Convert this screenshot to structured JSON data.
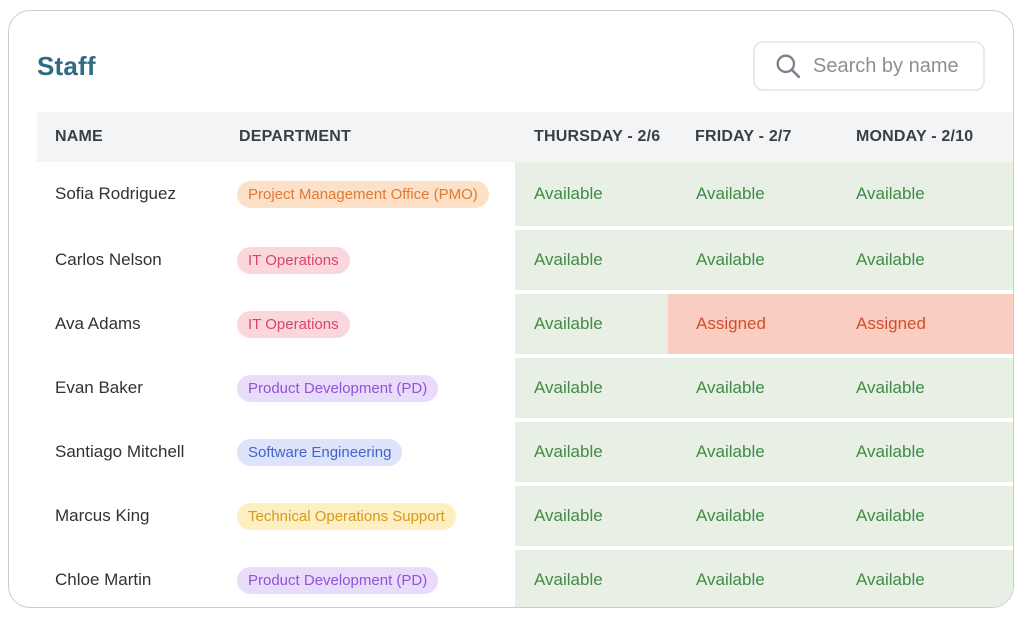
{
  "title": "Staff",
  "search": {
    "placeholder": "Search by name",
    "icon": "search-icon"
  },
  "columns": {
    "name": "NAME",
    "department": "DEPARTMENT",
    "day1": "THURSDAY - 2/6",
    "day2": "FRIDAY - 2/7",
    "day3": "MONDAY - 2/10"
  },
  "colors": {
    "title": "#2f6b82",
    "available_text": "#3f8a45",
    "available_bg": "#e8f0e6",
    "assigned_text": "#cf4f2f",
    "assigned_bg": "#f9cdbf"
  },
  "rows": [
    {
      "name": "Sofia Rodriguez",
      "department": "Project Management Office (PMO)",
      "dept_style": "pmo",
      "day1": "Available",
      "day2": "Available",
      "day3": "Available"
    },
    {
      "name": "Carlos Nelson",
      "department": "IT Operations",
      "dept_style": "it",
      "day1": "Available",
      "day2": "Available",
      "day3": "Available"
    },
    {
      "name": "Ava Adams",
      "department": "IT Operations",
      "dept_style": "it",
      "day1": "Available",
      "day2": "Assigned",
      "day3": "Assigned"
    },
    {
      "name": "Evan Baker",
      "department": "Product Development (PD)",
      "dept_style": "pd",
      "day1": "Available",
      "day2": "Available",
      "day3": "Available"
    },
    {
      "name": "Santiago Mitchell",
      "department": "Software Engineering",
      "dept_style": "se",
      "day1": "Available",
      "day2": "Available",
      "day3": "Available"
    },
    {
      "name": "Marcus King",
      "department": "Technical Operations Support",
      "dept_style": "tos",
      "day1": "Available",
      "day2": "Available",
      "day3": "Available"
    },
    {
      "name": "Chloe Martin",
      "department": "Product Development (PD)",
      "dept_style": "pd",
      "day1": "Available",
      "day2": "Available",
      "day3": "Available"
    }
  ]
}
